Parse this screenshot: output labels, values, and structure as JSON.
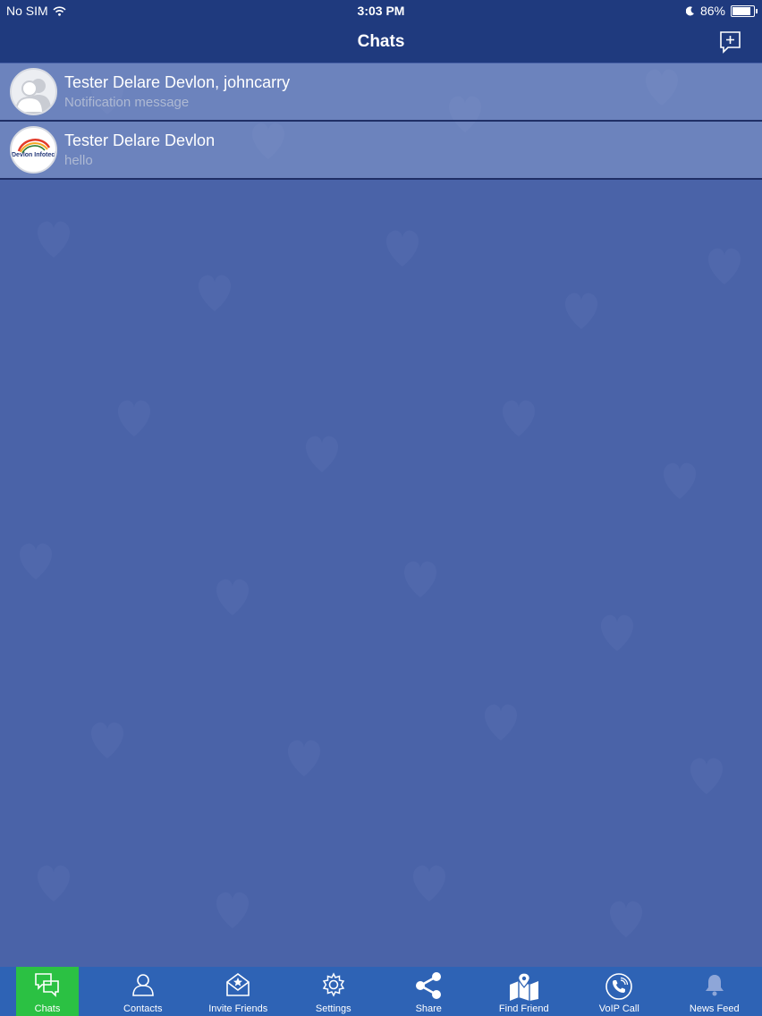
{
  "status_bar": {
    "carrier": "No SIM",
    "time": "3:03 PM",
    "battery": "86%",
    "battery_level": 0.86
  },
  "nav": {
    "title": "Chats"
  },
  "chats": [
    {
      "name": "Tester Delare Devlon, johncarry",
      "preview": "Notification message",
      "avatar": "group-avatar-icon"
    },
    {
      "name": "Tester Delare Devlon",
      "preview": "hello",
      "avatar": "devlon-infotech-logo",
      "logo_text": "Devlon Infotech"
    }
  ],
  "tabs": [
    {
      "label": "Chats",
      "icon": "chat-bubbles-icon",
      "active": true
    },
    {
      "label": "Contacts",
      "icon": "person-icon"
    },
    {
      "label": "Invite Friends",
      "icon": "envelope-icon"
    },
    {
      "label": "Settings",
      "icon": "gear-icon"
    },
    {
      "label": "Share",
      "icon": "share-icon"
    },
    {
      "label": "Find Friend",
      "icon": "map-pin-icon"
    },
    {
      "label": "VoIP Call",
      "icon": "phone-icon"
    },
    {
      "label": "News Feed",
      "icon": "bell-icon"
    }
  ],
  "colors": {
    "header": "#1f3a7e",
    "background": "#4a63a8",
    "tab_bar": "#2e63b5",
    "active_tab": "#2bc143"
  }
}
